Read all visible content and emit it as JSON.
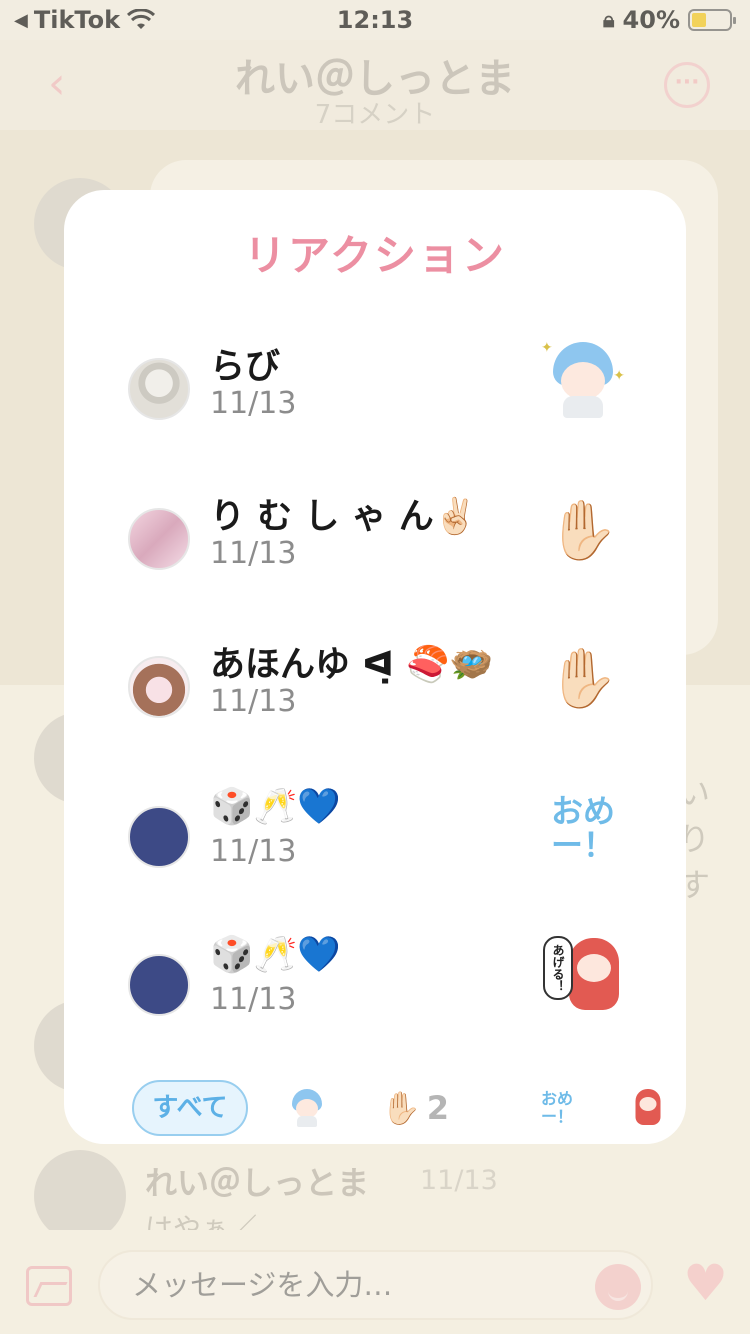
{
  "status_bar": {
    "carrier": "TikTok",
    "time": "12:13",
    "battery": "40%",
    "battery_level": 0.4
  },
  "header": {
    "title": "れい＠しっとま",
    "subtitle": "7コメント"
  },
  "background": {
    "side_text": "い\nり\nす",
    "comment_name": "れい＠しっとま",
    "comment_date": "11/13",
    "comment_text": "はやぁ／"
  },
  "input": {
    "placeholder": "メッセージを入力…"
  },
  "modal": {
    "title": "リアクション",
    "reactions": [
      {
        "name": "らび",
        "date": "11/13",
        "reaction": "sticker-blue-hair-boy"
      },
      {
        "name": "り む し ゃ ん✌🏻",
        "date": "11/13",
        "reaction": "✋🏻"
      },
      {
        "name": "あほんゆ ᐊ̣ 🍣🪺",
        "date": "11/13",
        "reaction": "✋🏻"
      },
      {
        "name": "🎲🥂💙",
        "date": "11/13",
        "reaction_text": "おめ\nー！"
      },
      {
        "name": "🎲🥂💙",
        "date": "11/13",
        "reaction": "sticker-red-hood-あげる"
      }
    ],
    "tabs": {
      "all_label": "すべて",
      "hand_count": "2",
      "ome_label": "おめ\nー！",
      "sticker_text": "あげる！"
    }
  },
  "colors": {
    "accent_pink": "#ec8fa2",
    "accent_blue": "#6fbbe8",
    "navy_avatar": "#3d4a86"
  }
}
